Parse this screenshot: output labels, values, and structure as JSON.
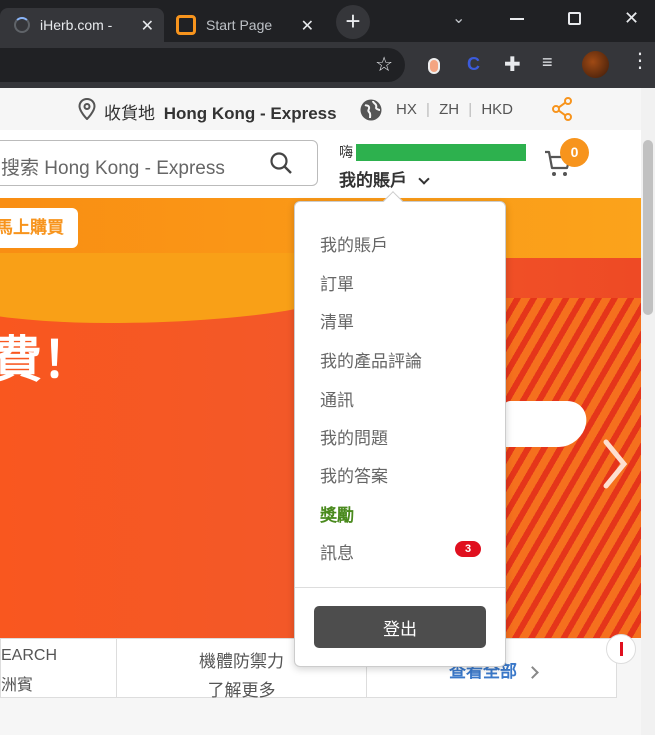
{
  "browser": {
    "tabs": [
      {
        "label": "iHerb.com -"
      },
      {
        "label": "Start Page"
      }
    ]
  },
  "shipping": {
    "prefix": "收貨地",
    "location": "Hong Kong - Express",
    "region": "HX",
    "language": "ZH",
    "currency": "HKD"
  },
  "header": {
    "search_placeholder": "搜索 Hong Kong - Express",
    "greeting": "嗨",
    "account_label": "我的賬戶",
    "cart_count": "0"
  },
  "banner": {
    "shop_now": "馬上購買",
    "headline": "費！"
  },
  "promo": {
    "col1_line1": "EARCH",
    "col1_line2": "洲賓",
    "col2_line1": "機體防禦力",
    "col2_line2": "了解更多",
    "view_all": "查看全部"
  },
  "dropdown": {
    "items": [
      {
        "label": "我的賬戶"
      },
      {
        "label": "訂單"
      },
      {
        "label": "清單"
      },
      {
        "label": "我的產品評論"
      },
      {
        "label": "通訊"
      },
      {
        "label": "我的問題"
      },
      {
        "label": "我的答案"
      },
      {
        "label": "獎勵"
      },
      {
        "label": "訊息",
        "badge": "3"
      }
    ],
    "signout_label": "登出"
  },
  "colors": {
    "accent_orange": "#f7941d",
    "rewards_green": "#4a8a1e",
    "badge_red": "#e0101f",
    "greeting_redaction": "#2db14e"
  }
}
